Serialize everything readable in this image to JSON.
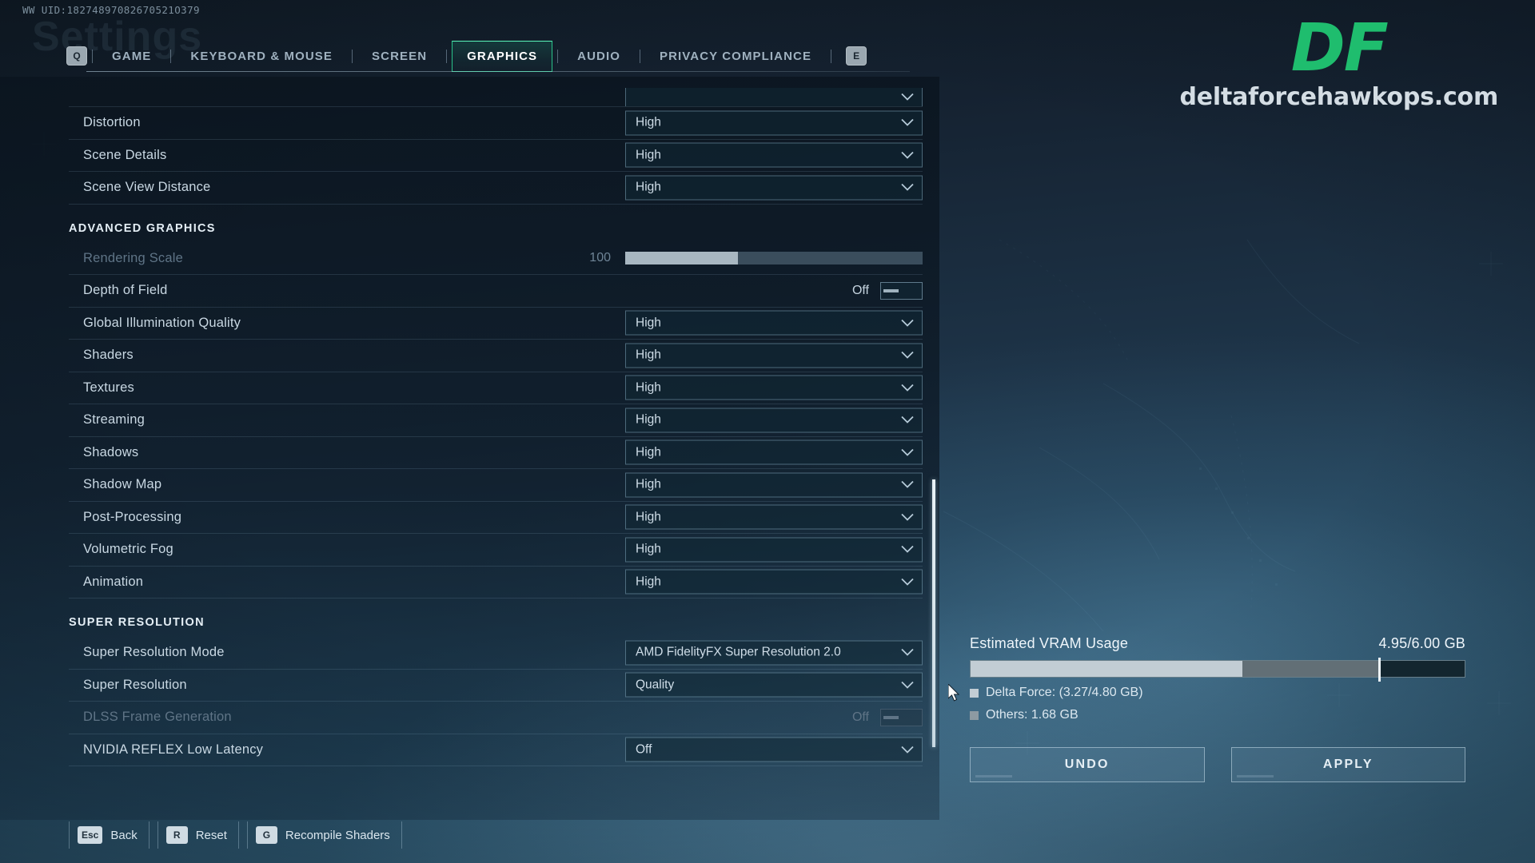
{
  "overlay": {
    "uid": "WW UID:18274897082670521O379",
    "ghost_title": "Settings"
  },
  "tabs": {
    "prev_key": "Q",
    "next_key": "E",
    "items": [
      {
        "label": "GAME",
        "active": false
      },
      {
        "label": "KEYBOARD & MOUSE",
        "active": false
      },
      {
        "label": "SCREEN",
        "active": false
      },
      {
        "label": "GRAPHICS",
        "active": true
      },
      {
        "label": "AUDIO",
        "active": false
      },
      {
        "label": "PRIVACY COMPLIANCE",
        "active": false
      }
    ]
  },
  "settings": {
    "groups": [
      {
        "title": "",
        "rows": [
          {
            "label": "",
            "type": "dropdown",
            "value": "",
            "partial": true,
            "disabled": false
          },
          {
            "label": "Distortion",
            "type": "dropdown",
            "value": "High",
            "disabled": false
          },
          {
            "label": "Scene Details",
            "type": "dropdown",
            "value": "High",
            "disabled": false
          },
          {
            "label": "Scene View Distance",
            "type": "dropdown",
            "value": "High",
            "disabled": false
          }
        ]
      },
      {
        "title": "ADVANCED GRAPHICS",
        "rows": [
          {
            "label": "Rendering Scale",
            "type": "slider",
            "value": "100",
            "fill_percent": 38,
            "disabled": true
          },
          {
            "label": "Depth of Field",
            "type": "toggle",
            "value": "Off",
            "disabled": false
          },
          {
            "label": "Global Illumination Quality",
            "type": "dropdown",
            "value": "High",
            "disabled": false
          },
          {
            "label": "Shaders",
            "type": "dropdown",
            "value": "High",
            "disabled": false
          },
          {
            "label": "Textures",
            "type": "dropdown",
            "value": "High",
            "disabled": false
          },
          {
            "label": "Streaming",
            "type": "dropdown",
            "value": "High",
            "disabled": false
          },
          {
            "label": "Shadows",
            "type": "dropdown",
            "value": "High",
            "disabled": false
          },
          {
            "label": "Shadow Map",
            "type": "dropdown",
            "value": "High",
            "disabled": false
          },
          {
            "label": "Post-Processing",
            "type": "dropdown",
            "value": "High",
            "disabled": false
          },
          {
            "label": "Volumetric Fog",
            "type": "dropdown",
            "value": "High",
            "disabled": false
          },
          {
            "label": "Animation",
            "type": "dropdown",
            "value": "High",
            "disabled": false
          }
        ]
      },
      {
        "title": "SUPER RESOLUTION",
        "rows": [
          {
            "label": "Super Resolution Mode",
            "type": "dropdown",
            "value": "AMD FidelityFX Super Resolution 2.0",
            "disabled": false
          },
          {
            "label": "Super Resolution",
            "type": "dropdown",
            "value": "Quality",
            "disabled": false
          },
          {
            "label": "DLSS Frame Generation",
            "type": "toggle",
            "value": "Off",
            "disabled": true
          },
          {
            "label": "NVIDIA REFLEX Low Latency",
            "type": "dropdown",
            "value": "Off",
            "disabled": false
          }
        ]
      }
    ]
  },
  "vram": {
    "title": "Estimated VRAM Usage",
    "amount": "4.95/6.00 GB",
    "segments": [
      {
        "name": "game",
        "percent": 55,
        "color": "#c2cdd4"
      },
      {
        "name": "others",
        "percent": 28,
        "color": "#626f76"
      }
    ],
    "tick_percent": 82.5,
    "legend": [
      {
        "label": "Delta Force: (3.27/4.80 GB)",
        "color": "#c2cdd4"
      },
      {
        "label": "Others: 1.68 GB",
        "color": "#8d9aa2"
      }
    ]
  },
  "actions": {
    "undo_label": "UNDO",
    "apply_label": "APPLY"
  },
  "bottom_hints": [
    {
      "key": "Esc",
      "label": "Back"
    },
    {
      "key": "R",
      "label": "Reset"
    },
    {
      "key": "G",
      "label": "Recompile Shaders"
    }
  ],
  "watermark": {
    "logo": "DF",
    "url": "deltaforcehawkops.com",
    "accent": "#1fbd6e"
  }
}
